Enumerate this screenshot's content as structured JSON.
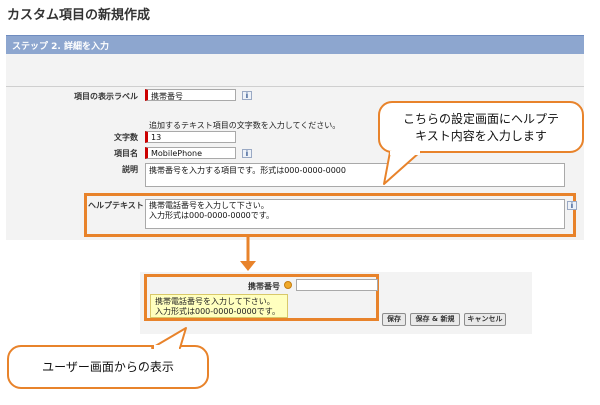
{
  "title": "カスタム項目の新規作成",
  "step_header": "ステップ 2. 詳細を入力",
  "form": {
    "display_label": {
      "label": "項目の表示ラベル",
      "value": "携帯番号"
    },
    "instruction": "追加するテキスト項目の文字数を入力してください。",
    "length": {
      "label": "文字数",
      "value": "13"
    },
    "field_name": {
      "label": "項目名",
      "value": "MobilePhone"
    },
    "description": {
      "label": "説明",
      "value": "携帯番号を入力する項目です。形式は000-0000-0000"
    },
    "help_text": {
      "label": "ヘルプテキスト",
      "line1": "携帯電話番号を入力して下さい。",
      "line2": "入力形式は000-0000-0000です。"
    },
    "info_icon_text": "i"
  },
  "callout_top": {
    "line1": "こちらの設定画面にヘルプテ",
    "line2": "キスト内容を入力します"
  },
  "callout_bottom": "ユーザー画面からの表示",
  "preview": {
    "field_label": "携帯番号",
    "tooltip_line1": "携帯電話番号を入力して下さい。",
    "tooltip_line2": "入力形式は000-0000-0000です。",
    "buttons": {
      "save": "保存",
      "save_new": "保存 & 新規",
      "cancel": "キャンセル"
    }
  },
  "colors": {
    "accent": "#e8832b",
    "header": "#8da6cf",
    "tooltip": "#ffffbf",
    "required": "#cc0000"
  }
}
